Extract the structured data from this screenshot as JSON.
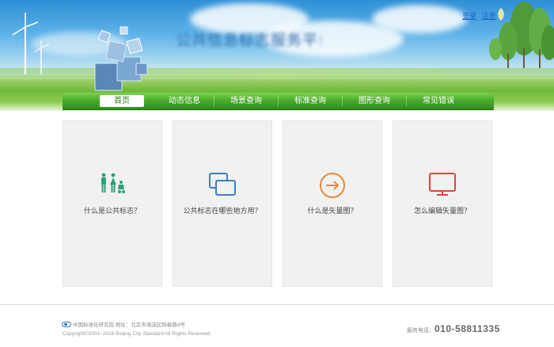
{
  "header": {
    "site_title": "公共信息标志服务平台",
    "login_link": "登录",
    "register_link": "注册"
  },
  "nav": {
    "items": [
      {
        "label": "首页",
        "active": true
      },
      {
        "label": "动态信息",
        "active": false
      },
      {
        "label": "场景查询",
        "active": false
      },
      {
        "label": "标准查询",
        "active": false
      },
      {
        "label": "图形查询",
        "active": false
      },
      {
        "label": "常见错误",
        "active": false
      }
    ]
  },
  "cards": [
    {
      "label": "什么是公共标志？",
      "icon": "public-sign-people-icon",
      "color": "#2aa07a"
    },
    {
      "label": "公共标志在哪些地方用？",
      "icon": "overlapping-windows-icon",
      "color": "#3a7fbf"
    },
    {
      "label": "什么是矢量图？",
      "icon": "arrow-circle-icon",
      "color": "#e58a3a"
    },
    {
      "label": "怎么编辑矢量图？",
      "icon": "monitor-icon",
      "color": "#d9463e"
    }
  ],
  "footer": {
    "org": "中国标准化研究院 地址：北京市海淀区知春路4号",
    "copyright": "Copyright©2001~2016 Beijing City Standard All Rights Reserved.",
    "phone_label": "服务电话：",
    "phone": "010-58811335"
  },
  "colors": {
    "nav_green": "#4aad2d",
    "link_blue": "#1d63c7",
    "card_bg": "#f1f1f1"
  }
}
